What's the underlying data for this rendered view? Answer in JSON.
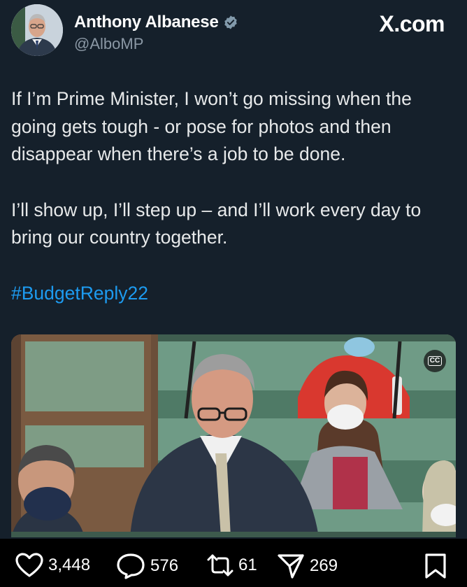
{
  "author": {
    "name": "Anthony Albanese",
    "handle": "@AlboMP",
    "verified": true
  },
  "brand": "X.com",
  "post": {
    "paragraph_1": "If I’m Prime Minister, I won’t go missing when the going gets tough - or pose for photos and then disappear when there’s a job to be done.",
    "paragraph_2": "I’ll show up, I’ll step up – and I’ll work every day to bring our country together.",
    "hashtag": "#BudgetReply22"
  },
  "media": {
    "cc_label": "CC"
  },
  "actions": {
    "likes": "3,448",
    "replies": "576",
    "reposts": "61",
    "shares": "269"
  },
  "colors": {
    "background": "#15202b",
    "hashtag": "#1d9bf0",
    "handle": "#8b98a5",
    "verified": "#829aab",
    "action_bar": "#000000"
  },
  "icons": [
    "verified-badge-icon",
    "cc-icon",
    "heart-icon",
    "reply-icon",
    "repost-icon",
    "share-icon",
    "bookmark-icon"
  ]
}
